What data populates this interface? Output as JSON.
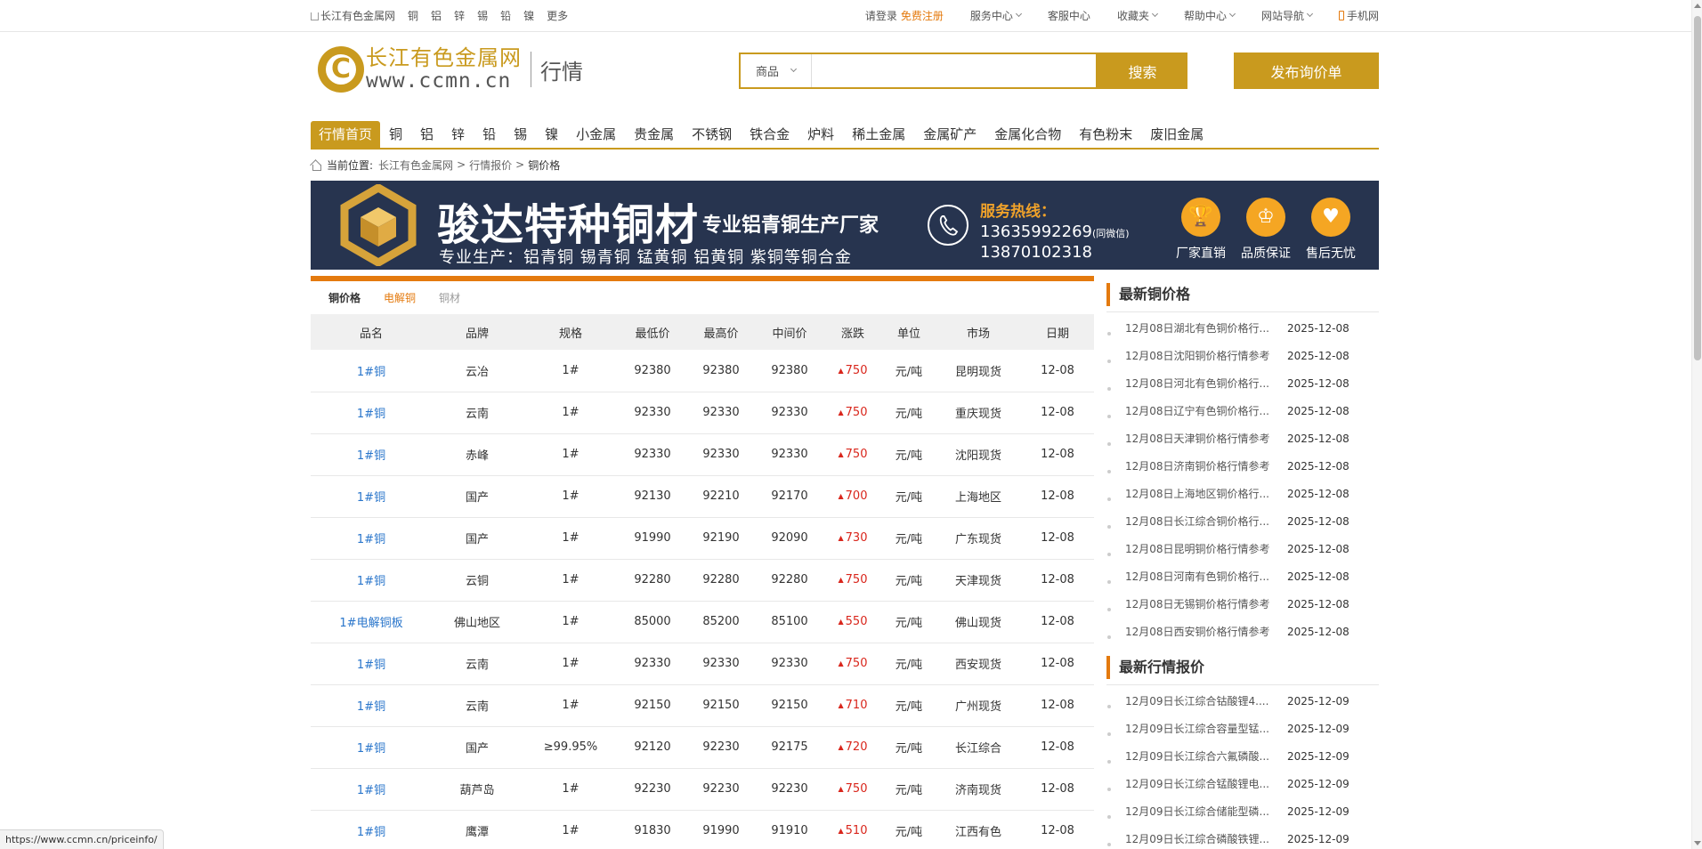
{
  "topbar": {
    "site": "长江有色金属网",
    "metals": [
      "铜",
      "铝",
      "锌",
      "锡",
      "铅",
      "镍",
      "更多"
    ],
    "login": "请登录",
    "register": "免费注册",
    "service": "服务中心",
    "support": "客服中心",
    "favorites": "收藏夹",
    "help": "帮助中心",
    "sitenav": "网站导航",
    "mobile": "手机网"
  },
  "header": {
    "logo_cn": "长江有色金属网",
    "logo_url": "www.ccmn.cn",
    "logo_sub": "行情",
    "search_category": "商品",
    "search_value": "",
    "search_button": "搜索",
    "publish_button": "发布询价单"
  },
  "nav": [
    "行情首页",
    "铜",
    "铝",
    "锌",
    "铅",
    "锡",
    "镍",
    "小金属",
    "贵金属",
    "不锈钢",
    "铁合金",
    "炉料",
    "稀土金属",
    "金属矿产",
    "金属化合物",
    "有色粉末",
    "废旧金属"
  ],
  "breadcrumb": {
    "label": "当前位置:",
    "items": [
      "长江有色金属网",
      "行情报价",
      "铜价格"
    ],
    "sep": ">"
  },
  "banner": {
    "title": "骏达特种铜材",
    "subtitle": "专业铝青铜生产厂家",
    "products": "专业生产：铝青铜 锡青铜 锰黄铜 铝黄铜 紫铜等铜合金",
    "hotline_label": "服务热线：",
    "phone1": "13635992269",
    "phone1_note": "(同微信)",
    "phone2": "13870102318",
    "badges": [
      "厂家直销",
      "品质保证",
      "售后无忧"
    ]
  },
  "tabs": [
    "铜价格",
    "电解铜",
    "铜材"
  ],
  "table": {
    "headers": [
      "品名",
      "品牌",
      "规格",
      "最低价",
      "最高价",
      "中间价",
      "涨跌",
      "单位",
      "市场",
      "日期"
    ],
    "rows": [
      [
        "1#铜",
        "云冶",
        "1#",
        "92380",
        "92380",
        "92380",
        "750",
        "元/吨",
        "昆明现货",
        "12-08"
      ],
      [
        "1#铜",
        "云南",
        "1#",
        "92330",
        "92330",
        "92330",
        "750",
        "元/吨",
        "重庆现货",
        "12-08"
      ],
      [
        "1#铜",
        "赤峰",
        "1#",
        "92330",
        "92330",
        "92330",
        "750",
        "元/吨",
        "沈阳现货",
        "12-08"
      ],
      [
        "1#铜",
        "国产",
        "1#",
        "92130",
        "92210",
        "92170",
        "700",
        "元/吨",
        "上海地区",
        "12-08"
      ],
      [
        "1#铜",
        "国产",
        "1#",
        "91990",
        "92190",
        "92090",
        "730",
        "元/吨",
        "广东现货",
        "12-08"
      ],
      [
        "1#铜",
        "云铜",
        "1#",
        "92280",
        "92280",
        "92280",
        "750",
        "元/吨",
        "天津现货",
        "12-08"
      ],
      [
        "1#电解铜板",
        "佛山地区",
        "1#",
        "85000",
        "85200",
        "85100",
        "550",
        "元/吨",
        "佛山现货",
        "12-08"
      ],
      [
        "1#铜",
        "云南",
        "1#",
        "92330",
        "92330",
        "92330",
        "750",
        "元/吨",
        "西安现货",
        "12-08"
      ],
      [
        "1#铜",
        "云南",
        "1#",
        "92150",
        "92150",
        "92150",
        "710",
        "元/吨",
        "广州现货",
        "12-08"
      ],
      [
        "1#铜",
        "国产",
        "≥99.95%",
        "92120",
        "92230",
        "92175",
        "720",
        "元/吨",
        "长江综合",
        "12-08"
      ],
      [
        "1#铜",
        "葫芦岛",
        "1#",
        "92230",
        "92230",
        "92230",
        "750",
        "元/吨",
        "济南现货",
        "12-08"
      ],
      [
        "1#铜",
        "鹰潭",
        "1#",
        "91830",
        "91990",
        "91910",
        "510",
        "元/吨",
        "江西有色",
        "12-08"
      ]
    ]
  },
  "sidebar": {
    "copper_title": "最新铜价格",
    "copper_items": [
      {
        "t": "12月08日湖北有色铜价格行...",
        "d": "2025-12-08"
      },
      {
        "t": "12月08日沈阳铜价格行情参考",
        "d": "2025-12-08"
      },
      {
        "t": "12月08日河北有色铜价格行...",
        "d": "2025-12-08"
      },
      {
        "t": "12月08日辽宁有色铜价格行...",
        "d": "2025-12-08"
      },
      {
        "t": "12月08日天津铜价格行情参考",
        "d": "2025-12-08"
      },
      {
        "t": "12月08日济南铜价格行情参考",
        "d": "2025-12-08"
      },
      {
        "t": "12月08日上海地区铜价格行...",
        "d": "2025-12-08"
      },
      {
        "t": "12月08日长江综合铜价格行...",
        "d": "2025-12-08"
      },
      {
        "t": "12月08日昆明铜价格行情参考",
        "d": "2025-12-08"
      },
      {
        "t": "12月08日河南有色铜价格行...",
        "d": "2025-12-08"
      },
      {
        "t": "12月08日无锡铜价格行情参考",
        "d": "2025-12-08"
      },
      {
        "t": "12月08日西安铜价格行情参考",
        "d": "2025-12-08"
      }
    ],
    "market_title": "最新行情报价",
    "market_items": [
      {
        "t": "12月09日长江综合钴酸锂4....",
        "d": "2025-12-09"
      },
      {
        "t": "12月09日长江综合容量型锰...",
        "d": "2025-12-09"
      },
      {
        "t": "12月09日长江综合六氟磷酸...",
        "d": "2025-12-09"
      },
      {
        "t": "12月09日长江综合锰酸锂电...",
        "d": "2025-12-09"
      },
      {
        "t": "12月09日长江综合储能型磷...",
        "d": "2025-12-09"
      },
      {
        "t": "12月09日长江综合磷酸铁锂...",
        "d": "2025-12-09"
      }
    ]
  },
  "statusbar": "https://www.ccmn.cn/priceinfo/"
}
